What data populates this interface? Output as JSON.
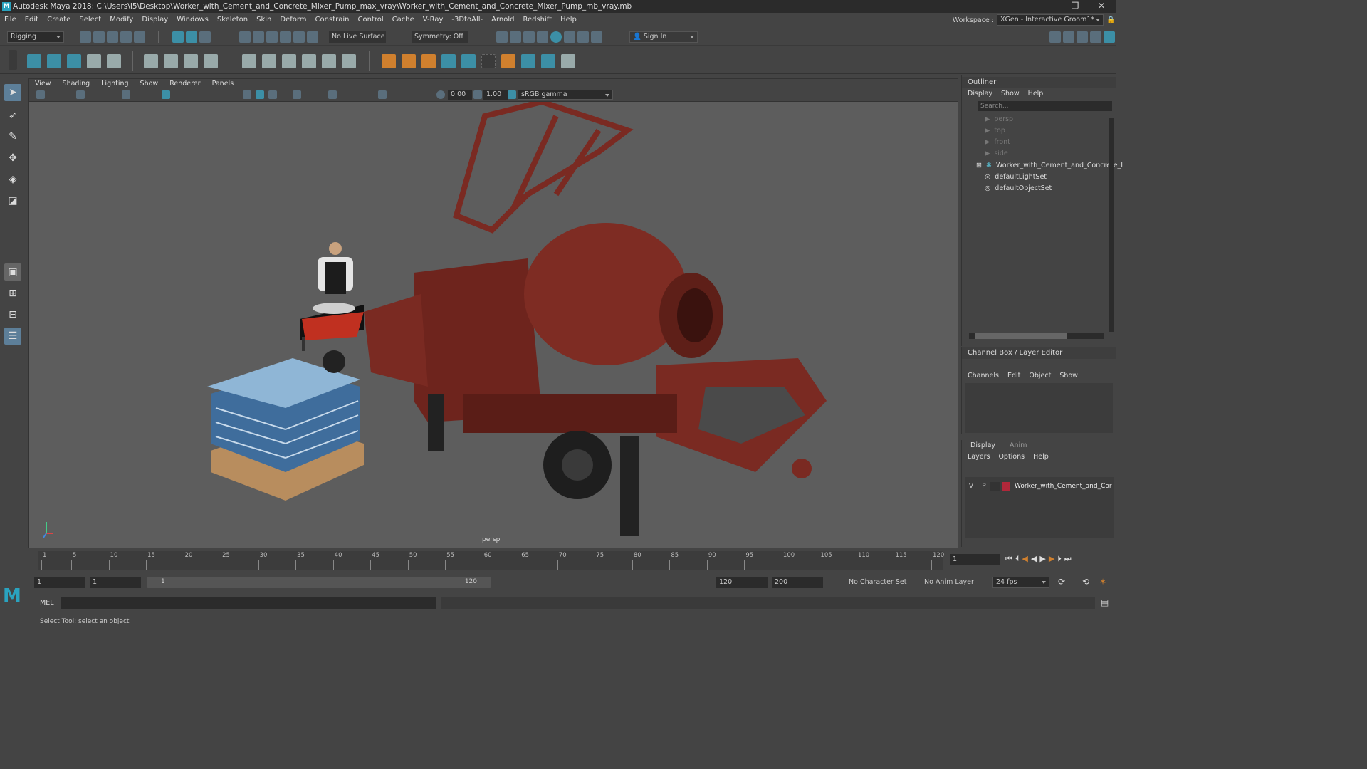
{
  "window": {
    "title": "Autodesk Maya 2018: C:\\Users\\I5\\Desktop\\Worker_with_Cement_and_Concrete_Mixer_Pump_max_vray\\Worker_with_Cement_and_Concrete_Mixer_Pump_mb_vray.mb",
    "logo": "M",
    "minimize": "–",
    "maximize": "❐",
    "close": "✕"
  },
  "menus": [
    "File",
    "Edit",
    "Create",
    "Select",
    "Modify",
    "Display",
    "Windows",
    "Skeleton",
    "Skin",
    "Deform",
    "Constrain",
    "Control",
    "Cache",
    "V-Ray",
    "-3DtoAll-",
    "Arnold",
    "Redshift",
    "Help"
  ],
  "workspace": {
    "label": "Workspace :",
    "value": "XGen - Interactive Groom1*"
  },
  "status": {
    "mode": "Rigging",
    "live_surface": "No Live Surface",
    "symmetry": "Symmetry: Off",
    "sign_in": "Sign In"
  },
  "viewport": {
    "menus": [
      "View",
      "Shading",
      "Lighting",
      "Show",
      "Renderer",
      "Panels"
    ],
    "exposure": "0.00",
    "gamma": "1.00",
    "color_space": "sRGB gamma",
    "camera": "persp"
  },
  "outliner": {
    "title": "Outliner",
    "menus": [
      "Display",
      "Show",
      "Help"
    ],
    "search_placeholder": "Search...",
    "items": [
      "persp",
      "top",
      "front",
      "side",
      "Worker_with_Cement_and_Concrete_I",
      "defaultLightSet",
      "defaultObjectSet"
    ]
  },
  "channel_box": {
    "title": "Channel Box / Layer Editor",
    "menus": [
      "Channels",
      "Edit",
      "Object",
      "Show"
    ]
  },
  "layer_editor": {
    "tabs": [
      "Display",
      "Anim"
    ],
    "menus": [
      "Layers",
      "Options",
      "Help"
    ],
    "layer": {
      "v": "V",
      "p": "P",
      "name": "Worker_with_Cement_and_Cor",
      "color": "#b0283a"
    }
  },
  "timeline": {
    "ticks": [
      "1",
      "5",
      "10",
      "15",
      "20",
      "25",
      "30",
      "35",
      "40",
      "45",
      "50",
      "55",
      "60",
      "65",
      "70",
      "75",
      "80",
      "85",
      "90",
      "95",
      "100",
      "105",
      "110",
      "115",
      "120"
    ],
    "current": "1"
  },
  "range": {
    "start": "1",
    "inner_start": "1",
    "slider_start": "1",
    "slider_end": "120",
    "end": "120",
    "max": "200",
    "character_set": "No Character Set",
    "anim_layer": "No Anim Layer",
    "fps": "24 fps"
  },
  "command": {
    "label": "MEL"
  },
  "help": {
    "text": "Select Tool: select an object"
  },
  "colors": {
    "mixer": "#7a2a22",
    "bg": "#444444"
  }
}
